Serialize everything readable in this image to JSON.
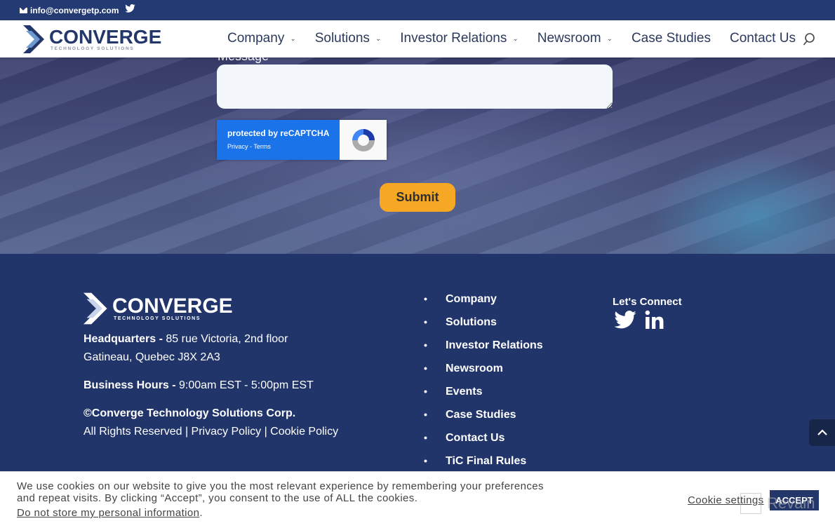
{
  "topbar": {
    "email": "info@convergetp.com",
    "icons": [
      "mail-icon",
      "twitter-icon"
    ]
  },
  "header": {
    "logo": {
      "name": "CONVERGE",
      "tagline": "TECHNOLOGY SOLUTIONS"
    },
    "nav": [
      {
        "label": "Company",
        "has_dropdown": true
      },
      {
        "label": "Solutions",
        "has_dropdown": true
      },
      {
        "label": "Investor Relations",
        "has_dropdown": true
      },
      {
        "label": "Newsroom",
        "has_dropdown": true
      },
      {
        "label": "Case Studies",
        "has_dropdown": false
      },
      {
        "label": "Contact Us",
        "has_dropdown": false
      }
    ],
    "search_icon": "search-icon"
  },
  "form": {
    "message_label": "Message",
    "message_value": "",
    "recaptcha": {
      "line1": "protected by reCAPTCHA",
      "line2": "Privacy - Terms"
    },
    "submit_label": "Submit"
  },
  "footer": {
    "logo": {
      "name": "CONVERGE",
      "tagline": "TECHNOLOGY SOLUTIONS"
    },
    "hq_label": "Headquarters - ",
    "hq_line1": "85 rue Victoria, 2nd floor",
    "hq_line2": "Gatineau, Quebec J8X 2A3",
    "hours_label": "Business Hours - ",
    "hours_value": "9:00am EST - 5:00pm EST",
    "copyright": "©Converge Technology Solutions Corp.",
    "rights": "All Rights Reserved",
    "privacy_policy": "Privacy Policy",
    "cookie_policy": "Cookie Policy",
    "separator": " | ",
    "links": [
      "Company",
      "Solutions",
      "Investor Relations",
      "Newsroom",
      "Events",
      "Case Studies",
      "Contact Us",
      "TiC Final Rules"
    ],
    "connect_title": "Let's Connect",
    "social": [
      "twitter-icon",
      "linkedin-icon"
    ]
  },
  "cookie_bar": {
    "text": "We use cookies on our website to give you the most relevant experience by remembering your preferences and repeat visits. By clicking “Accept”, you consent to the use of ALL the cookies.",
    "do_not_store": "Do not store my personal information",
    "period": ".",
    "settings_label": "Cookie settings",
    "accept_label": "ACCEPT"
  },
  "watermark": "Revain",
  "colors": {
    "brand_navy": "#21356b",
    "topbar": "#243a72",
    "submit": "#f6a723",
    "recaptcha_blue": "#1a73e8"
  }
}
